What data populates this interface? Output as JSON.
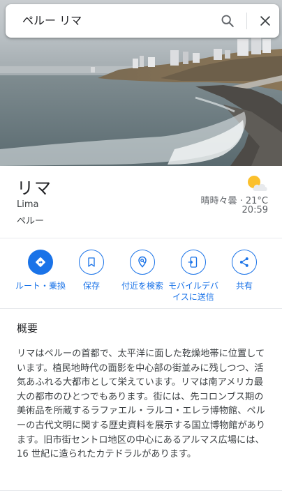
{
  "search": {
    "query": "ペルー リマ"
  },
  "icons": {
    "search": "search-icon",
    "close": "close-icon",
    "weather": "partly-cloudy-icon"
  },
  "place": {
    "name": "リマ",
    "latin_name": "Lima",
    "country": "ペルー"
  },
  "weather": {
    "summary": "晴時々曇 · 21°C",
    "time": "20:59"
  },
  "actions": [
    {
      "label": "ルート・乗換",
      "icon": "directions-icon"
    },
    {
      "label": "保存",
      "icon": "bookmark-icon"
    },
    {
      "label": "付近を検索",
      "icon": "nearby-search-icon"
    },
    {
      "label": "モバイルデバイスに送信",
      "icon": "send-to-phone-icon"
    },
    {
      "label": "共有",
      "icon": "share-icon"
    }
  ],
  "overview": {
    "heading": "概要",
    "text": "リマはペルーの首都で、太平洋に面した乾燥地帯に位置しています。植民地時代の面影を中心部の街並みに残しつつ、活気あふれる大都市として栄えています。リマは南アメリカ最大の都市のひとつでもあります。街には、先コロンブス期の美術品を所蔵するラファエル・ラルコ・エレラ博物館、ペルーの古代文明に関する歴史資料を展示する国立博物館があります。旧市街セントロ地区の中心にあるアルマス広場には、16 世紀に造られたカテドラルがあります。"
  },
  "colors": {
    "accent": "#1a73e8",
    "text": "#202124",
    "secondary": "#5f6368"
  }
}
